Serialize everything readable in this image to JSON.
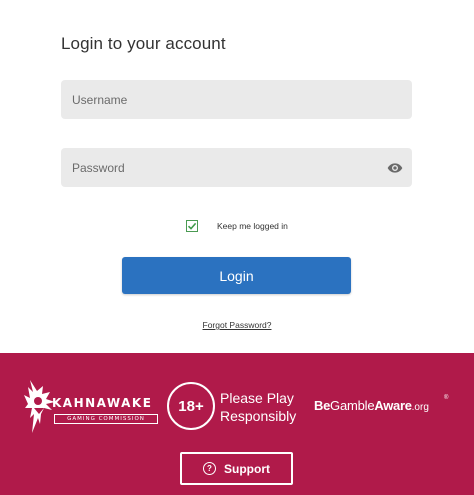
{
  "login": {
    "title": "Login to your account",
    "username_placeholder": "Username",
    "password_placeholder": "Password",
    "keep_logged_in_label": "Keep me logged in",
    "keep_logged_in_checked": true,
    "login_button_label": "Login",
    "forgot_password_label": "Forgot Password?"
  },
  "footer": {
    "kahnawake_name": "KAHNAWAKE",
    "kahnawake_sub": "GAMING COMMISSION",
    "age_badge": "18+",
    "play_line1": "Please Play",
    "play_line2": "Responsibly",
    "bga_be": "Be",
    "bga_gamble": "Gamble",
    "bga_aware": "Aware",
    "bga_org": ".org",
    "bga_reg": "®",
    "support_label": "Support",
    "support_icon_glyph": "?"
  },
  "colors": {
    "footer_bg": "#b01a4a",
    "login_button": "#2b72c0",
    "field_bg": "#eaeaea",
    "checkbox_green": "#4a9a52"
  },
  "icons": {
    "password_toggle": "eye-icon",
    "checkbox": "checkmark-icon",
    "support": "question-circle-icon",
    "kahnawake": "feather-headdress-icon"
  }
}
